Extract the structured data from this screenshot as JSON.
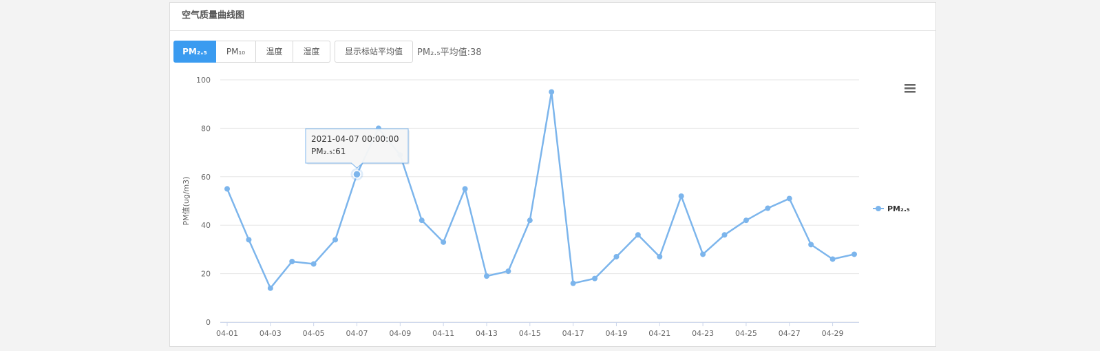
{
  "panel": {
    "title": "空气质量曲线图"
  },
  "toolbar": {
    "tabs": [
      {
        "label": "PM₂.₅",
        "active": true
      },
      {
        "label": "PM₁₀",
        "active": false
      },
      {
        "label": "温度",
        "active": false
      },
      {
        "label": "湿度",
        "active": false
      }
    ],
    "avg_button": "显示标站平均值",
    "avg_text": "PM₂.₅平均值:38"
  },
  "colors": {
    "accent": "#3a9bf0",
    "series": "#7cb5ec",
    "grid": "#e6e6e6"
  },
  "menu_icon": "hamburger-menu-icon",
  "chart_data": {
    "type": "line",
    "ylabel": "PM值(ug/m3)",
    "xlabel": "",
    "ylim": [
      0,
      100
    ],
    "yticks": [
      0,
      20,
      40,
      60,
      80,
      100
    ],
    "x": [
      "04-01",
      "04-02",
      "04-03",
      "04-04",
      "04-05",
      "04-06",
      "04-07",
      "04-08",
      "04-09",
      "04-10",
      "04-11",
      "04-12",
      "04-13",
      "04-14",
      "04-15",
      "04-16",
      "04-17",
      "04-18",
      "04-19",
      "04-20",
      "04-21",
      "04-22",
      "04-23",
      "04-24",
      "04-25",
      "04-26",
      "04-27",
      "04-28",
      "04-29",
      "04-30"
    ],
    "xtick_labels": [
      "04-01",
      "04-03",
      "04-05",
      "04-07",
      "04-09",
      "04-11",
      "04-13",
      "04-15",
      "04-17",
      "04-19",
      "04-21",
      "04-23",
      "04-25",
      "04-27",
      "04-29"
    ],
    "series": [
      {
        "name": "PM₂.₅",
        "values": [
          55,
          34,
          14,
          25,
          24,
          34,
          61,
          80,
          69,
          42,
          33,
          55,
          19,
          21,
          42,
          95,
          16,
          18,
          27,
          36,
          27,
          52,
          28,
          36,
          42,
          47,
          51,
          32,
          26,
          28
        ]
      }
    ],
    "legend": "right",
    "grid": true,
    "tooltip": {
      "index": 6,
      "title": "2021-04-07 00:00:00",
      "text": "PM₂.₅:61"
    }
  }
}
